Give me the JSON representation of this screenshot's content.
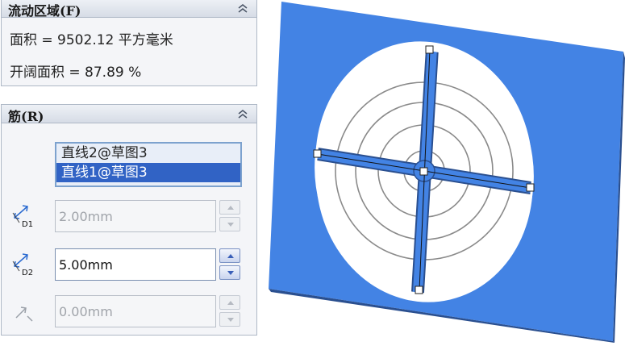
{
  "flow_section": {
    "title": "流动区域(F)",
    "area_line": "面积 = 9502.12 平方毫米",
    "open_area_line": "开阔面积 = 87.89 %"
  },
  "rib_section": {
    "title": "筋(R)",
    "entities": [
      {
        "label": "直线2@草图3",
        "selected": false
      },
      {
        "label": "直线1@草图3",
        "selected": true
      }
    ],
    "d1": {
      "value": "2.00mm",
      "icon_label": "D1",
      "enabled": false
    },
    "d2": {
      "value": "5.00mm",
      "icon_label": "D2",
      "enabled": true
    },
    "offset": {
      "value": "0.00mm",
      "enabled": false
    }
  },
  "colors": {
    "model_face": "#4383e4",
    "edge_dark": "#2a4f8f",
    "sketch_circle": "#8a8a8a",
    "selected_item": "#3163c5"
  },
  "icons": {
    "collapse": "double-chevron-up-icon",
    "dimension": "dimension-arrow-icon",
    "offset": "offset-arrow-icon"
  }
}
